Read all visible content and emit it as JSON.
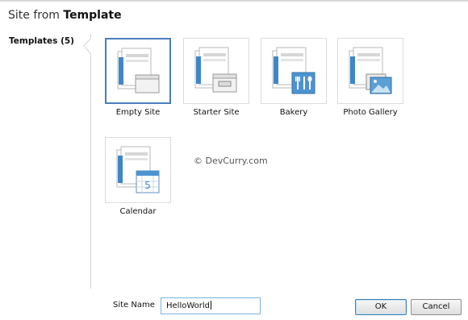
{
  "dialog": {
    "title_prefix": "Site from",
    "title_bold": "Template"
  },
  "sidebar": {
    "label": "Templates (5)"
  },
  "templates": [
    {
      "label": "Empty Site",
      "icon": "empty-site-icon",
      "selected": true
    },
    {
      "label": "Starter Site",
      "icon": "starter-site-icon",
      "selected": false
    },
    {
      "label": "Bakery",
      "icon": "bakery-icon",
      "selected": false
    },
    {
      "label": "Photo Gallery",
      "icon": "photo-gallery-icon",
      "selected": false
    },
    {
      "label": "Calendar",
      "icon": "calendar-icon",
      "selected": false,
      "badge": "5"
    }
  ],
  "watermark": "© DevCurry.com",
  "form": {
    "site_name_label": "Site Name",
    "site_name_value": "HelloWorld"
  },
  "buttons": {
    "ok": "OK",
    "cancel": "Cancel"
  },
  "colors": {
    "selection_border": "#4a7fb8",
    "icon_blue": "#3f86c8",
    "input_border": "#7ab3dd"
  }
}
